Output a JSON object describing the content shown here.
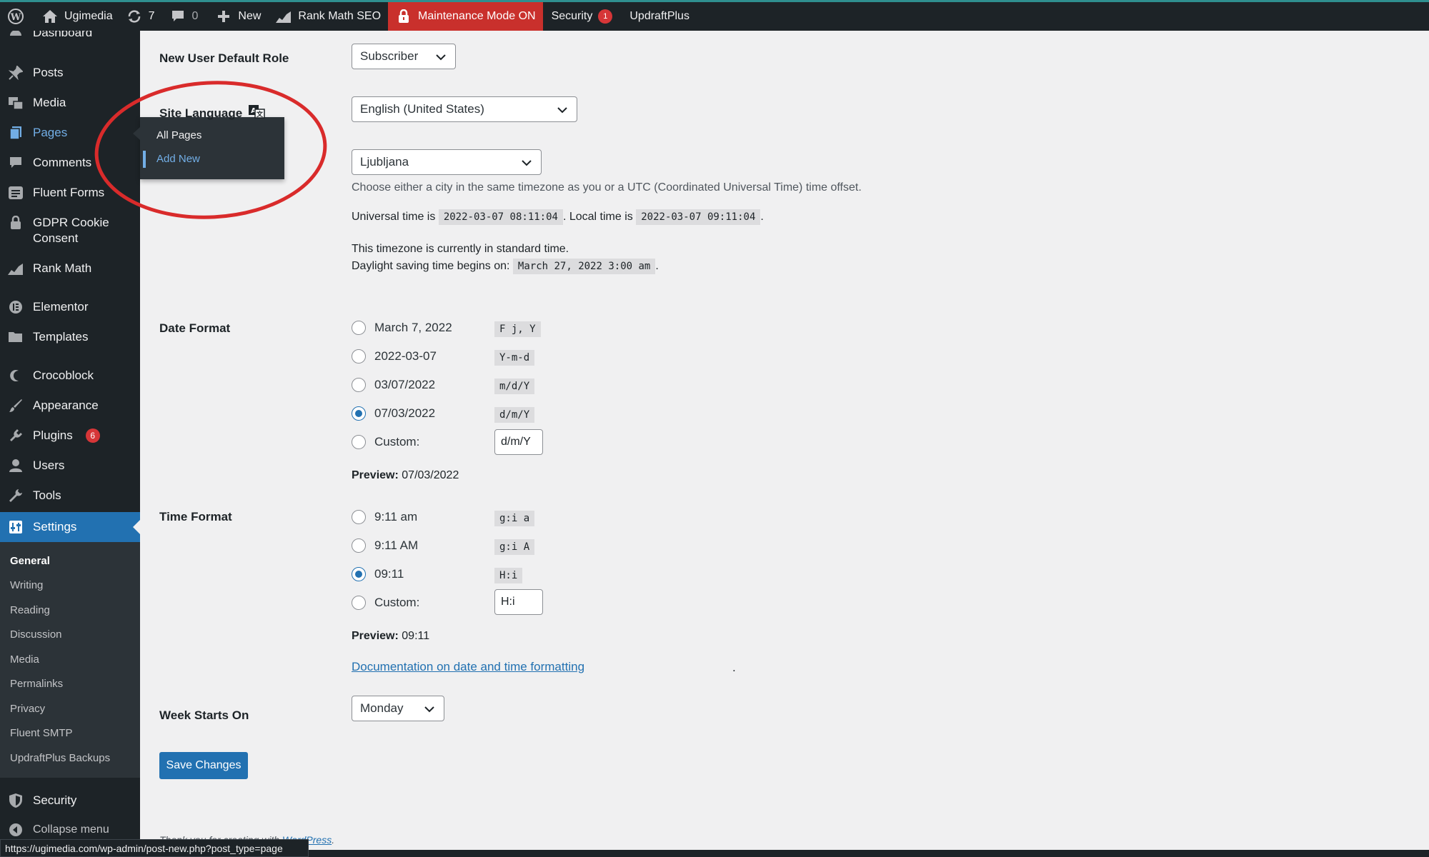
{
  "admin_bar": {
    "site_name": "Ugimedia",
    "updates_count": "7",
    "comments_count": "0",
    "new_label": "New",
    "rank_math_label": "Rank Math SEO",
    "maintenance_label": "Maintenance Mode ON",
    "security_label": "Security",
    "security_badge": "1",
    "updraft_label": "UpdraftPlus"
  },
  "sidebar": {
    "items": [
      {
        "label": "Dashboard",
        "icon": "dashboard-icon"
      },
      {
        "label": "Posts",
        "icon": "pin-icon"
      },
      {
        "label": "Media",
        "icon": "media-icon"
      },
      {
        "label": "Pages",
        "icon": "pages-icon"
      },
      {
        "label": "Comments",
        "icon": "comment-icon"
      },
      {
        "label": "Fluent Forms",
        "icon": "forms-icon"
      },
      {
        "label": "GDPR Cookie",
        "label2": "Consent",
        "icon": "lock-icon"
      },
      {
        "label": "Rank Math",
        "icon": "chart-icon"
      },
      {
        "label": "Elementor",
        "icon": "elementor-icon"
      },
      {
        "label": "Templates",
        "icon": "folder-icon"
      },
      {
        "label": "Crocoblock",
        "icon": "crocoblock-icon"
      },
      {
        "label": "Appearance",
        "icon": "brush-icon"
      },
      {
        "label": "Plugins",
        "icon": "plug-icon",
        "badge": "6"
      },
      {
        "label": "Users",
        "icon": "user-icon"
      },
      {
        "label": "Tools",
        "icon": "wrench-icon"
      },
      {
        "label": "Settings",
        "icon": "settings-icon"
      },
      {
        "label": "Security",
        "icon": "shield-icon"
      },
      {
        "label": "Collapse menu",
        "icon": "collapse-icon"
      }
    ],
    "submenu": [
      "General",
      "Writing",
      "Reading",
      "Discussion",
      "Media",
      "Permalinks",
      "Privacy",
      "Fluent SMTP",
      "UpdraftPlus Backups"
    ]
  },
  "flyout": {
    "items": [
      "All Pages",
      "Add New"
    ]
  },
  "form": {
    "default_role_label": "New User Default Role",
    "default_role_value": "Subscriber",
    "site_language_label": "Site Language",
    "site_language_value": "English (United States)",
    "timezone_value": "Ljubljana",
    "timezone_desc": "Choose either a city in the same timezone as you or a UTC (Coordinated Universal Time) time offset.",
    "universal_prefix": "Universal time is",
    "universal_time": "2022-03-07 08:11:04",
    "local_prefix": ". Local time is",
    "local_time": "2022-03-07 09:11:04",
    "local_suffix": ".",
    "standard_time_text": "This timezone is currently in standard time.",
    "dst_prefix": "Daylight saving time begins on:",
    "dst_date": "March 27, 2022 3:00 am",
    "dst_suffix": ".",
    "date_format_label": "Date Format",
    "date_formats": [
      {
        "label": "March 7, 2022",
        "code": "F j, Y",
        "checked": false
      },
      {
        "label": "2022-03-07",
        "code": "Y-m-d",
        "checked": false
      },
      {
        "label": "03/07/2022",
        "code": "m/d/Y",
        "checked": false
      },
      {
        "label": "07/03/2022",
        "code": "d/m/Y",
        "checked": true
      },
      {
        "label": "Custom:",
        "checked": false
      }
    ],
    "date_custom_value": "d/m/Y",
    "preview_label": "Preview:",
    "date_preview": "07/03/2022",
    "time_format_label": "Time Format",
    "time_formats": [
      {
        "label": "9:11 am",
        "code": "g:i a",
        "checked": false
      },
      {
        "label": "9:11 AM",
        "code": "g:i A",
        "checked": false
      },
      {
        "label": "09:11",
        "code": "H:i",
        "checked": true
      },
      {
        "label": "Custom:",
        "checked": false
      }
    ],
    "time_custom_value": "H:i",
    "time_preview": "09:11",
    "doc_link": "Documentation on date and time formatting",
    "doc_link_suffix": ".",
    "week_start_label": "Week Starts On",
    "week_start_value": "Monday",
    "save_label": "Save Changes",
    "footer_left": "Thank you for creating with ",
    "footer_link": "WordPress",
    "footer_suffix": "."
  },
  "status_url": "https://ugimedia.com/wp-admin/post-new.php?post_type=page",
  "colors": {
    "accent": "#2271b1",
    "admin_bar": "#1d2327",
    "maintenance": "#c9302c",
    "annotation": "#d92b2b"
  }
}
